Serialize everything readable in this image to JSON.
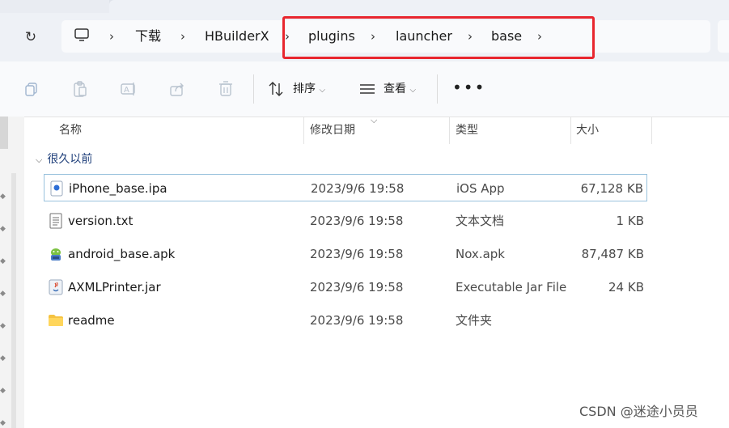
{
  "breadcrumb": {
    "items": [
      "下载",
      "HBuilderX",
      "plugins",
      "launcher",
      "base"
    ],
    "separator": "›"
  },
  "toolbar": {
    "sort_label": "排序",
    "view_label": "查看",
    "more_label": "•••"
  },
  "columns": {
    "name": "名称",
    "date": "修改日期",
    "type": "类型",
    "size": "大小"
  },
  "group": {
    "label": "很久以前"
  },
  "files": [
    {
      "name": "iPhone_base.ipa",
      "date": "2023/9/6 19:58",
      "type": "iOS App",
      "size": "67,128 KB",
      "icon": "ipa-file-icon",
      "selected": true
    },
    {
      "name": "version.txt",
      "date": "2023/9/6 19:58",
      "type": "文本文档",
      "size": "1 KB",
      "icon": "text-file-icon",
      "selected": false
    },
    {
      "name": "android_base.apk",
      "date": "2023/9/6 19:58",
      "type": "Nox.apk",
      "size": "87,487 KB",
      "icon": "apk-file-icon",
      "selected": false
    },
    {
      "name": "AXMLPrinter.jar",
      "date": "2023/9/6 19:58",
      "type": "Executable Jar File",
      "size": "24 KB",
      "icon": "jar-file-icon",
      "selected": false
    },
    {
      "name": "readme",
      "date": "2023/9/6 19:58",
      "type": "文件夹",
      "size": "",
      "icon": "folder-icon",
      "selected": false
    }
  ],
  "watermark": "CSDN @迷途小员员",
  "colors": {
    "highlight_red": "#e8262e",
    "selection_border": "#99c2dd",
    "folder_yellow": "#f5c342"
  }
}
